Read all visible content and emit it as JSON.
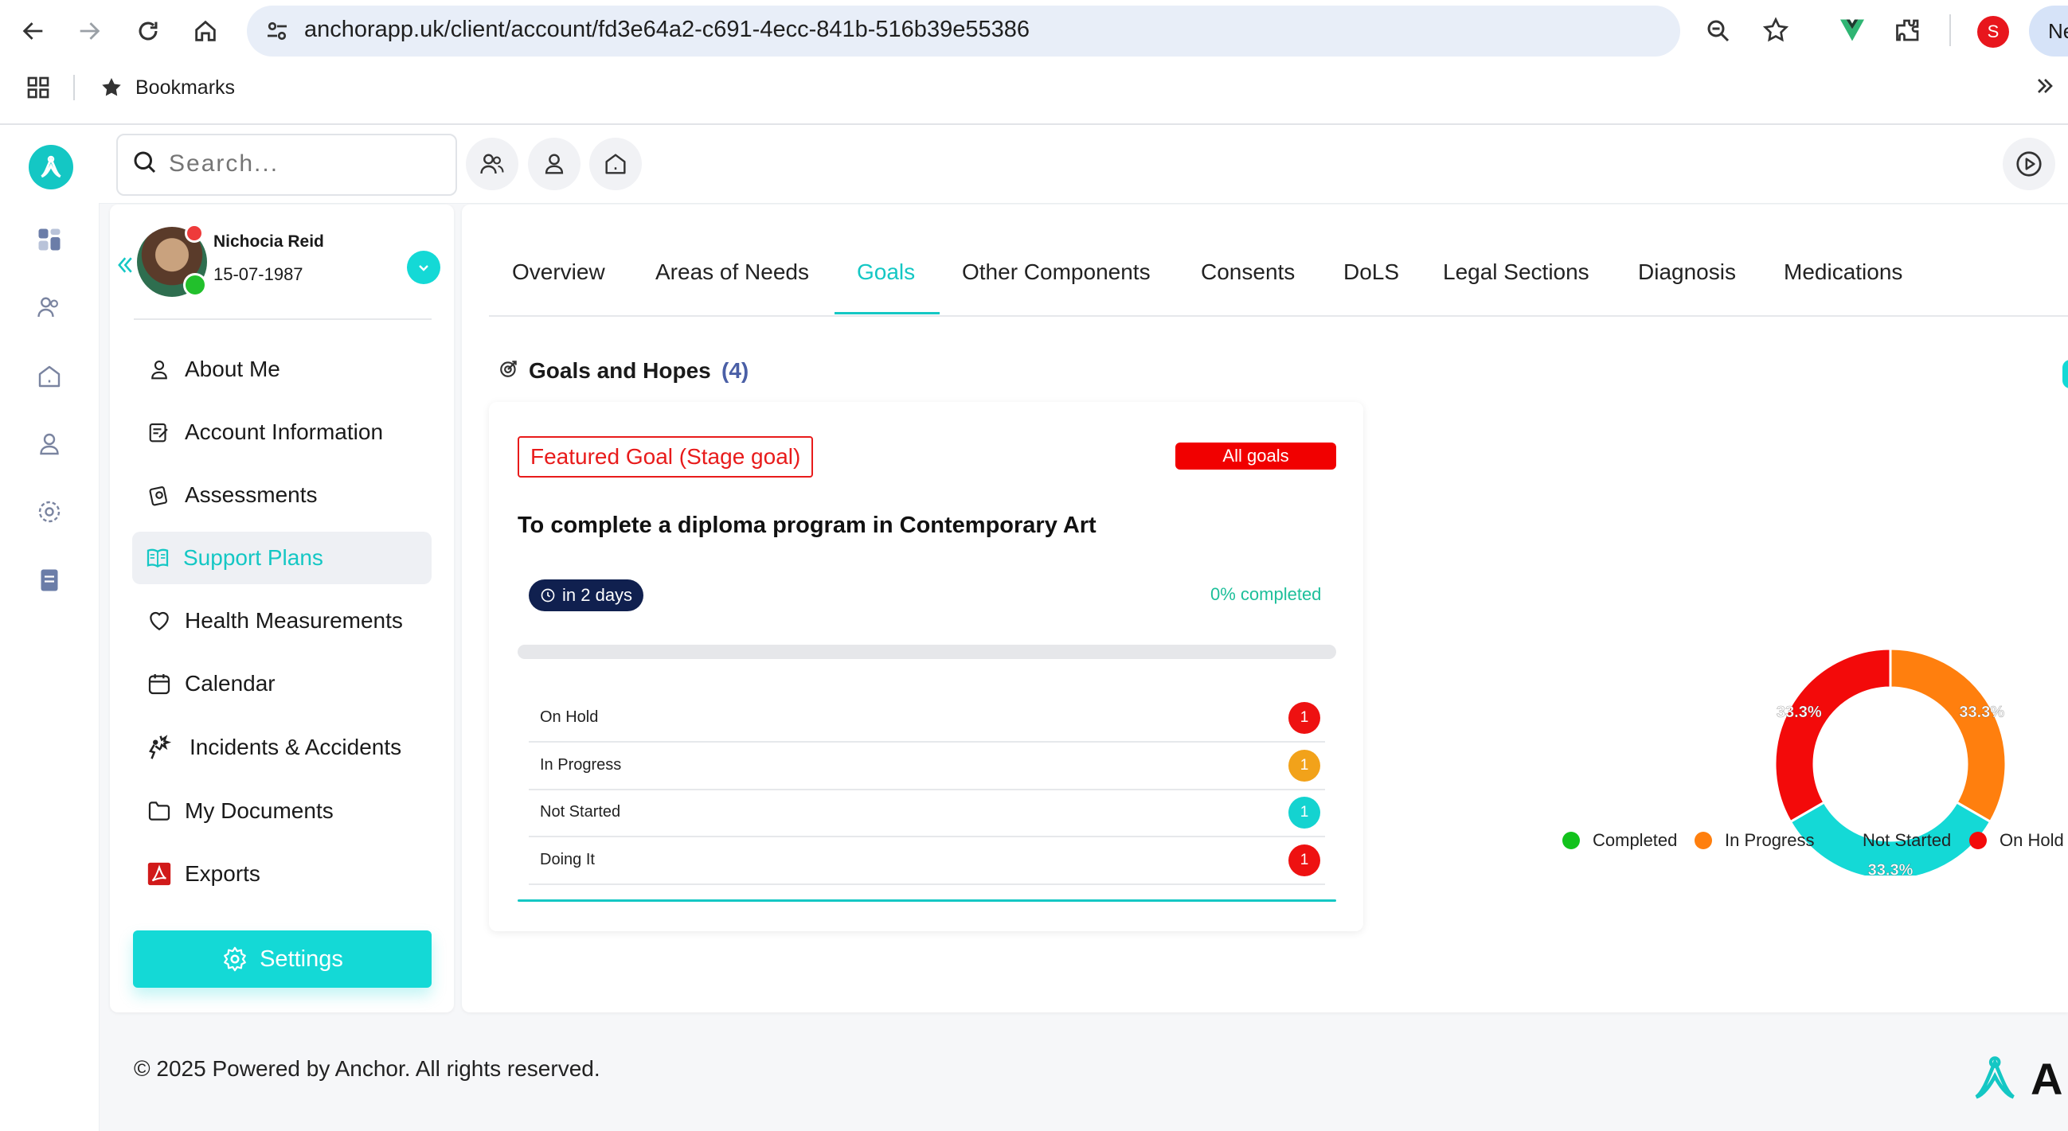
{
  "browser": {
    "url": "anchorapp.uk/client/account/fd3e64a2-c691-4ecc-841b-516b39e55386",
    "bookmarks_label": "Bookmarks",
    "profile_initial": "S",
    "partial_button_text": "Ne"
  },
  "search": {
    "placeholder": "Search..."
  },
  "client": {
    "name": "Nichocia Reid",
    "dob": "15-07-1987"
  },
  "menu": [
    {
      "label": "About Me",
      "icon": "person-icon"
    },
    {
      "label": "Account Information",
      "icon": "edit-document-icon"
    },
    {
      "label": "Assessments",
      "icon": "assessment-icon"
    },
    {
      "label": "Support Plans",
      "icon": "book-icon",
      "active": true
    },
    {
      "label": "Health Measurements",
      "icon": "heart-icon"
    },
    {
      "label": "Calendar",
      "icon": "calendar-icon"
    },
    {
      "label": "Incidents & Accidents",
      "icon": "incident-icon"
    },
    {
      "label": "My Documents",
      "icon": "folder-icon"
    },
    {
      "label": "Exports",
      "icon": "pdf-icon"
    }
  ],
  "settings_label": "Settings",
  "tabs": [
    "Overview",
    "Areas of Needs",
    "Goals",
    "Other Components",
    "Consents",
    "DoLS",
    "Legal Sections",
    "Diagnosis",
    "Medications"
  ],
  "active_tab": "Goals",
  "goals": {
    "heading": "Goals and Hopes",
    "count": "(4)",
    "featured_label": "Featured Goal (Stage goal)",
    "all_goals_label": "All goals",
    "goal_title": "To complete a diploma program in Contemporary Art",
    "due": "in 2 days",
    "completed_text": "0% completed",
    "progress": 0,
    "statuses": [
      {
        "label": "On Hold",
        "count": "1",
        "color": "#ee1111"
      },
      {
        "label": "In Progress",
        "count": "1",
        "color": "#f2a21a"
      },
      {
        "label": "Not Started",
        "count": "1",
        "color": "#14d3d0"
      },
      {
        "label": "Doing It",
        "count": "1",
        "color": "#ee1111"
      }
    ]
  },
  "chart_data": {
    "type": "pie",
    "donut": true,
    "categories": [
      "Completed",
      "In Progress",
      "Not Started",
      "On Hold"
    ],
    "values": [
      0,
      33.3,
      33.3,
      33.3
    ],
    "data_labels": [
      "",
      "33.3%",
      "33.3%",
      "33.3%"
    ],
    "colors": [
      "#12c21c",
      "#ff7f0e",
      "#14d9d6",
      "#f30a0a"
    ],
    "legend": "bottom"
  },
  "footer": {
    "copyright": "© 2025 Powered by Anchor. All rights reserved.",
    "brand_partial": "A"
  }
}
